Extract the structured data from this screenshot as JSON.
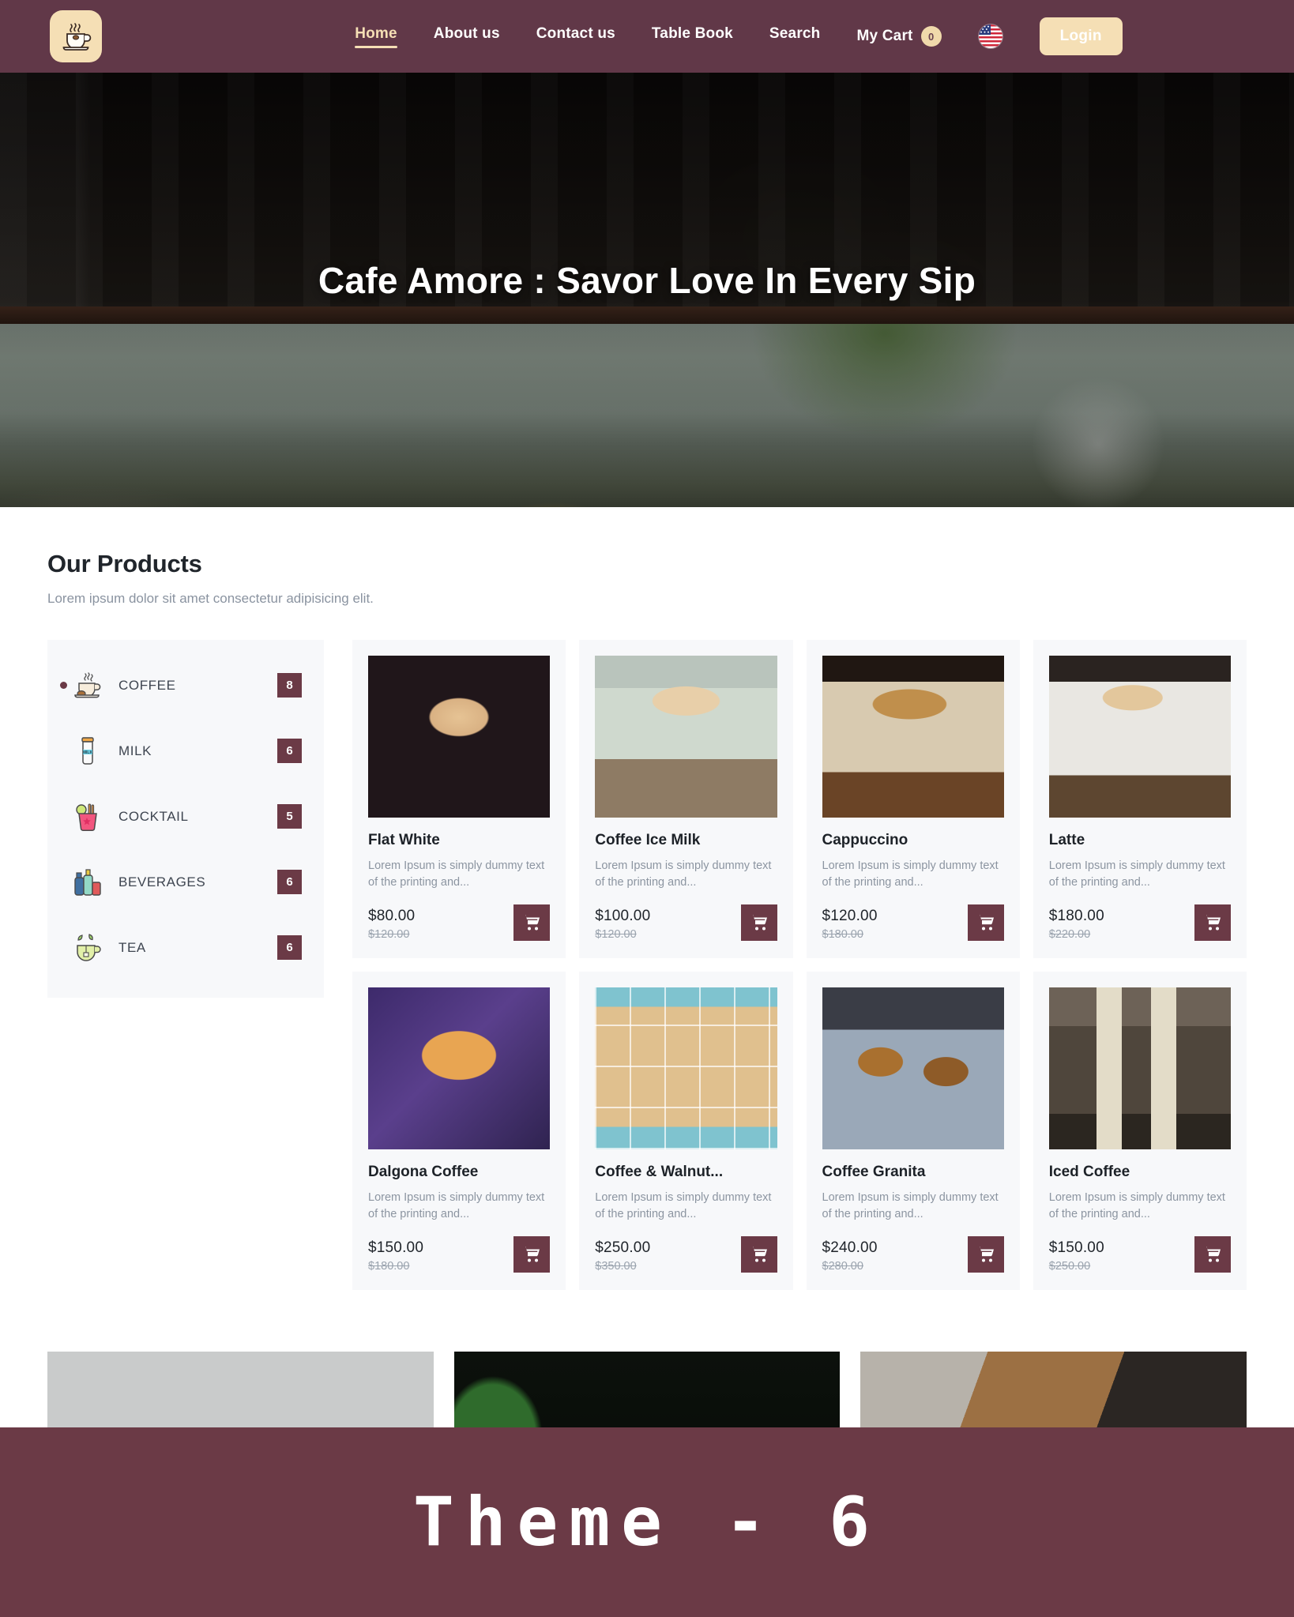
{
  "brand": {
    "logo_icon": "coffee-cup-icon",
    "logo_bg": "#f5dfb5"
  },
  "colors": {
    "header_bg": "#613848",
    "accent_maroon": "#6b3a46",
    "accent_cream": "#f5dfb5",
    "card_bg": "#f7f8fa"
  },
  "nav": {
    "items": [
      {
        "label": "Home",
        "active": true
      },
      {
        "label": "About us",
        "active": false
      },
      {
        "label": "Contact us",
        "active": false
      },
      {
        "label": "Table Book",
        "active": false
      },
      {
        "label": "Search",
        "active": false
      }
    ],
    "cart_label": "My Cart",
    "cart_count": "0",
    "flag_icon": "us-flag-icon",
    "login_label": "Login"
  },
  "hero": {
    "title": "Cafe Amore : Savor Love In Every Sip"
  },
  "products_section": {
    "title": "Our Products",
    "subtitle": "Lorem ipsum dolor sit amet consectetur adipisicing elit."
  },
  "categories": [
    {
      "label": "COFFEE",
      "count": "8",
      "icon": "coffee-cup-icon",
      "active": true
    },
    {
      "label": "MILK",
      "count": "6",
      "icon": "milk-bottle-icon",
      "active": false
    },
    {
      "label": "COCKTAIL",
      "count": "5",
      "icon": "cocktail-icon",
      "active": false
    },
    {
      "label": "BEVERAGES",
      "count": "6",
      "icon": "beverages-icon",
      "active": false
    },
    {
      "label": "TEA",
      "count": "6",
      "icon": "tea-cup-icon",
      "active": false
    }
  ],
  "products": [
    {
      "name": "Flat White",
      "desc": "Lorem Ipsum is simply dummy text of the printing and...",
      "price": "$80.00",
      "old_price": "$120.00",
      "cart_icon": "shopping-cart-icon"
    },
    {
      "name": "Coffee Ice Milk",
      "desc": "Lorem Ipsum is simply dummy text of the printing and...",
      "price": "$100.00",
      "old_price": "$120.00",
      "cart_icon": "shopping-cart-icon"
    },
    {
      "name": "Cappuccino",
      "desc": "Lorem Ipsum is simply dummy text of the printing and...",
      "price": "$120.00",
      "old_price": "$180.00",
      "cart_icon": "shopping-cart-icon"
    },
    {
      "name": "Latte",
      "desc": "Lorem Ipsum is simply dummy text of the printing and...",
      "price": "$180.00",
      "old_price": "$220.00",
      "cart_icon": "shopping-cart-icon"
    },
    {
      "name": "Dalgona Coffee",
      "desc": "Lorem Ipsum is simply dummy text of the printing and...",
      "price": "$150.00",
      "old_price": "$180.00",
      "cart_icon": "shopping-cart-icon"
    },
    {
      "name": "Coffee & Walnut...",
      "desc": "Lorem Ipsum is simply dummy text of the printing and...",
      "price": "$250.00",
      "old_price": "$350.00",
      "cart_icon": "shopping-cart-icon"
    },
    {
      "name": "Coffee Granita",
      "desc": "Lorem Ipsum is simply dummy text of the printing and...",
      "price": "$240.00",
      "old_price": "$280.00",
      "cart_icon": "shopping-cart-icon"
    },
    {
      "name": "Iced Coffee",
      "desc": "Lorem Ipsum is simply dummy text of the printing and...",
      "price": "$150.00",
      "old_price": "$250.00",
      "cart_icon": "shopping-cart-icon"
    }
  ],
  "gallery": [
    {
      "alt": "coffee-beans-in-bowl"
    },
    {
      "alt": "coffee-table-with-plants"
    },
    {
      "alt": "hand-holding-latte-art"
    }
  ],
  "banner": {
    "text": "Theme - 6"
  }
}
